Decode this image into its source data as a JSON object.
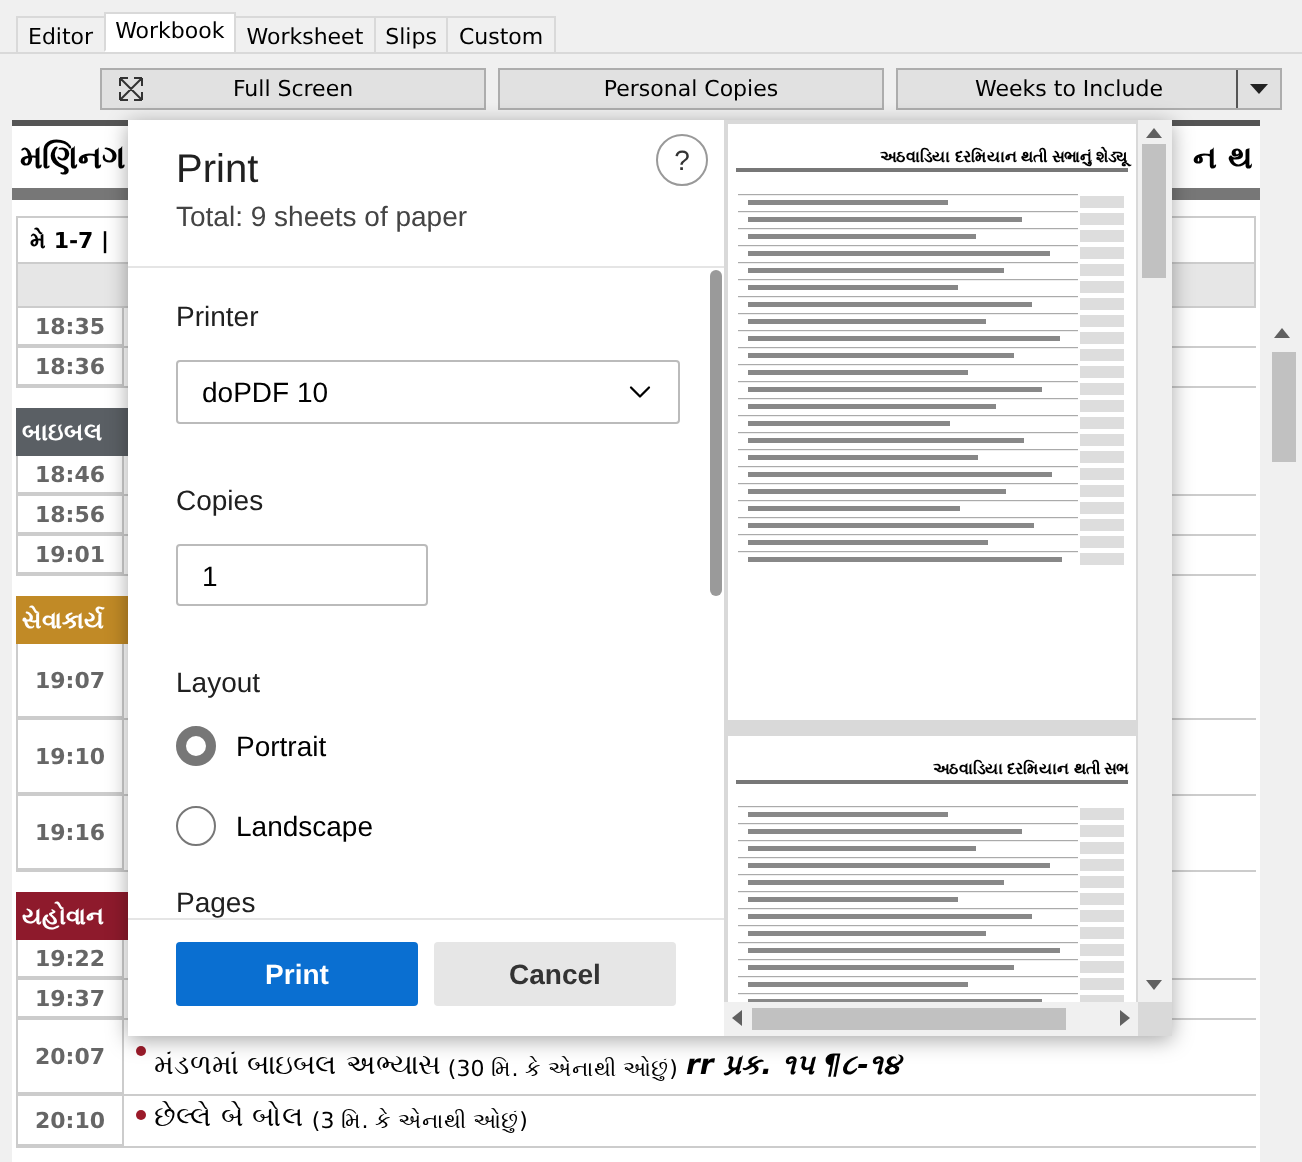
{
  "tabs": [
    {
      "label": "Editor",
      "selected": false
    },
    {
      "label": "Workbook",
      "selected": true
    },
    {
      "label": "Worksheet",
      "selected": false
    },
    {
      "label": "Slips",
      "selected": false
    },
    {
      "label": "Custom",
      "selected": false
    }
  ],
  "toolbar": {
    "full_screen": "Full Screen",
    "personal_copies": "Personal Copies",
    "weeks": "Weeks to Include"
  },
  "document": {
    "heading_left": "મણિનગ",
    "heading_right": "ન થ",
    "week": "મે 1-7 |",
    "rows": [
      {
        "kind": "time",
        "time": "18:35"
      },
      {
        "kind": "time",
        "time": "18:36"
      },
      {
        "kind": "section",
        "label": "બાઇબલ",
        "color": "#5a5f64"
      },
      {
        "kind": "time",
        "time": "18:46"
      },
      {
        "kind": "time",
        "time": "18:56"
      },
      {
        "kind": "time",
        "time": "19:01"
      },
      {
        "kind": "section",
        "label": "સેવાકાર્ય",
        "color": "#c18a26"
      },
      {
        "kind": "tall",
        "time": "19:07"
      },
      {
        "kind": "tall",
        "time": "19:10"
      },
      {
        "kind": "tall",
        "time": "19:16"
      },
      {
        "kind": "section",
        "label": "યહોવાન",
        "color": "#8e1a2c"
      },
      {
        "kind": "time",
        "time": "19:22"
      },
      {
        "kind": "time",
        "time": "19:37"
      },
      {
        "kind": "item",
        "time": "20:07",
        "title": "મંડળમાં બાઇબલ અભ્યાસ",
        "note": "(30 મિ. કે એનાથી ઓછું)",
        "ref": "rr પ્રક. ૧૫ ¶૮-૧૪"
      },
      {
        "kind": "item",
        "time": "20:10",
        "title": "છેલ્લે બે બોલ",
        "note": "(3 મિ. કે એનાથી ઓછું)"
      }
    ]
  },
  "dialog": {
    "title": "Print",
    "subtitle": "Total: 9 sheets of paper",
    "help": "?",
    "printer_label": "Printer",
    "printer": "doPDF 10",
    "copies_label": "Copies",
    "copies": "1",
    "layout_label": "Layout",
    "layout_options": [
      {
        "label": "Portrait",
        "selected": true
      },
      {
        "label": "Landscape",
        "selected": false
      }
    ],
    "pages_label": "Pages",
    "print_button": "Print",
    "cancel_button": "Cancel",
    "preview_pages": [
      {
        "heading": "અઠવાડિયા દરમિયાન થતી સભાનું શેડ્યૂ"
      },
      {
        "heading": "અઠવાડિયા દરમિયાન થતી સભ"
      }
    ]
  }
}
